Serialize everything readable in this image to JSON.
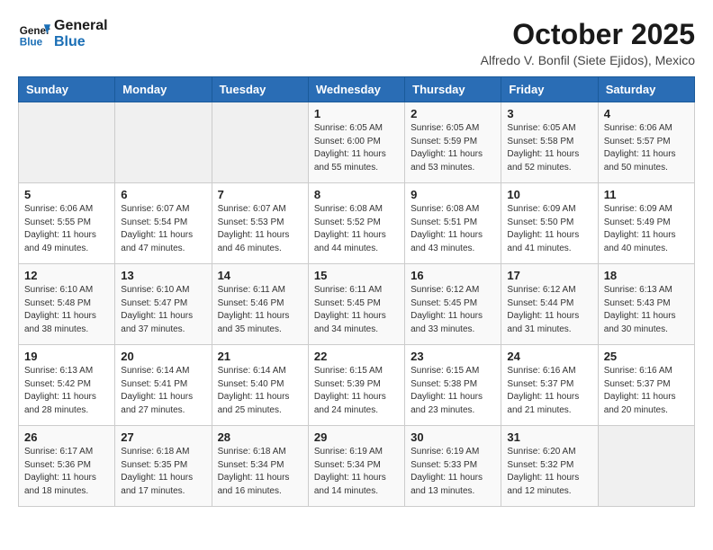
{
  "header": {
    "logo_line1": "General",
    "logo_line2": "Blue",
    "month": "October 2025",
    "location": "Alfredo V. Bonfil (Siete Ejidos), Mexico"
  },
  "weekdays": [
    "Sunday",
    "Monday",
    "Tuesday",
    "Wednesday",
    "Thursday",
    "Friday",
    "Saturday"
  ],
  "weeks": [
    [
      {
        "day": "",
        "text": ""
      },
      {
        "day": "",
        "text": ""
      },
      {
        "day": "",
        "text": ""
      },
      {
        "day": "1",
        "text": "Sunrise: 6:05 AM\nSunset: 6:00 PM\nDaylight: 11 hours and 55 minutes."
      },
      {
        "day": "2",
        "text": "Sunrise: 6:05 AM\nSunset: 5:59 PM\nDaylight: 11 hours and 53 minutes."
      },
      {
        "day": "3",
        "text": "Sunrise: 6:05 AM\nSunset: 5:58 PM\nDaylight: 11 hours and 52 minutes."
      },
      {
        "day": "4",
        "text": "Sunrise: 6:06 AM\nSunset: 5:57 PM\nDaylight: 11 hours and 50 minutes."
      }
    ],
    [
      {
        "day": "5",
        "text": "Sunrise: 6:06 AM\nSunset: 5:55 PM\nDaylight: 11 hours and 49 minutes."
      },
      {
        "day": "6",
        "text": "Sunrise: 6:07 AM\nSunset: 5:54 PM\nDaylight: 11 hours and 47 minutes."
      },
      {
        "day": "7",
        "text": "Sunrise: 6:07 AM\nSunset: 5:53 PM\nDaylight: 11 hours and 46 minutes."
      },
      {
        "day": "8",
        "text": "Sunrise: 6:08 AM\nSunset: 5:52 PM\nDaylight: 11 hours and 44 minutes."
      },
      {
        "day": "9",
        "text": "Sunrise: 6:08 AM\nSunset: 5:51 PM\nDaylight: 11 hours and 43 minutes."
      },
      {
        "day": "10",
        "text": "Sunrise: 6:09 AM\nSunset: 5:50 PM\nDaylight: 11 hours and 41 minutes."
      },
      {
        "day": "11",
        "text": "Sunrise: 6:09 AM\nSunset: 5:49 PM\nDaylight: 11 hours and 40 minutes."
      }
    ],
    [
      {
        "day": "12",
        "text": "Sunrise: 6:10 AM\nSunset: 5:48 PM\nDaylight: 11 hours and 38 minutes."
      },
      {
        "day": "13",
        "text": "Sunrise: 6:10 AM\nSunset: 5:47 PM\nDaylight: 11 hours and 37 minutes."
      },
      {
        "day": "14",
        "text": "Sunrise: 6:11 AM\nSunset: 5:46 PM\nDaylight: 11 hours and 35 minutes."
      },
      {
        "day": "15",
        "text": "Sunrise: 6:11 AM\nSunset: 5:45 PM\nDaylight: 11 hours and 34 minutes."
      },
      {
        "day": "16",
        "text": "Sunrise: 6:12 AM\nSunset: 5:45 PM\nDaylight: 11 hours and 33 minutes."
      },
      {
        "day": "17",
        "text": "Sunrise: 6:12 AM\nSunset: 5:44 PM\nDaylight: 11 hours and 31 minutes."
      },
      {
        "day": "18",
        "text": "Sunrise: 6:13 AM\nSunset: 5:43 PM\nDaylight: 11 hours and 30 minutes."
      }
    ],
    [
      {
        "day": "19",
        "text": "Sunrise: 6:13 AM\nSunset: 5:42 PM\nDaylight: 11 hours and 28 minutes."
      },
      {
        "day": "20",
        "text": "Sunrise: 6:14 AM\nSunset: 5:41 PM\nDaylight: 11 hours and 27 minutes."
      },
      {
        "day": "21",
        "text": "Sunrise: 6:14 AM\nSunset: 5:40 PM\nDaylight: 11 hours and 25 minutes."
      },
      {
        "day": "22",
        "text": "Sunrise: 6:15 AM\nSunset: 5:39 PM\nDaylight: 11 hours and 24 minutes."
      },
      {
        "day": "23",
        "text": "Sunrise: 6:15 AM\nSunset: 5:38 PM\nDaylight: 11 hours and 23 minutes."
      },
      {
        "day": "24",
        "text": "Sunrise: 6:16 AM\nSunset: 5:37 PM\nDaylight: 11 hours and 21 minutes."
      },
      {
        "day": "25",
        "text": "Sunrise: 6:16 AM\nSunset: 5:37 PM\nDaylight: 11 hours and 20 minutes."
      }
    ],
    [
      {
        "day": "26",
        "text": "Sunrise: 6:17 AM\nSunset: 5:36 PM\nDaylight: 11 hours and 18 minutes."
      },
      {
        "day": "27",
        "text": "Sunrise: 6:18 AM\nSunset: 5:35 PM\nDaylight: 11 hours and 17 minutes."
      },
      {
        "day": "28",
        "text": "Sunrise: 6:18 AM\nSunset: 5:34 PM\nDaylight: 11 hours and 16 minutes."
      },
      {
        "day": "29",
        "text": "Sunrise: 6:19 AM\nSunset: 5:34 PM\nDaylight: 11 hours and 14 minutes."
      },
      {
        "day": "30",
        "text": "Sunrise: 6:19 AM\nSunset: 5:33 PM\nDaylight: 11 hours and 13 minutes."
      },
      {
        "day": "31",
        "text": "Sunrise: 6:20 AM\nSunset: 5:32 PM\nDaylight: 11 hours and 12 minutes."
      },
      {
        "day": "",
        "text": ""
      }
    ]
  ]
}
